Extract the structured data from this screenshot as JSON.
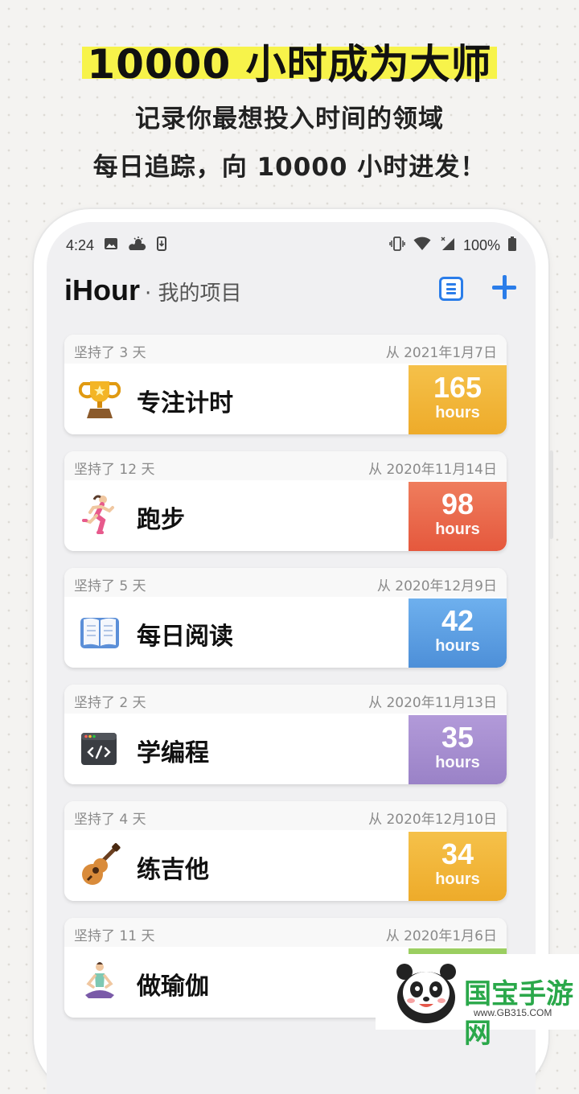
{
  "promo": {
    "title": "10000 小时成为大师",
    "subtitle1": "记录你最想投入时间的领域",
    "subtitle2": "每日追踪，向 10000 小时进发！"
  },
  "status_bar": {
    "time": "4:24",
    "battery": "100%",
    "icons": [
      "image-icon",
      "weather-icon",
      "download-icon",
      "vibrate-icon",
      "wifi-icon",
      "signal-icon",
      "battery-icon"
    ]
  },
  "appbar": {
    "app_name": "iHour",
    "subtitle": "· 我的项目",
    "list_icon": "list-icon",
    "add_icon": "plus-icon",
    "accent": "#2b7de9"
  },
  "projects": [
    {
      "kept": "坚持了 3 天",
      "since": "从 2021年1月7日",
      "name": "专注计时",
      "hours": "165",
      "unit": "hours",
      "icon": "trophy-icon",
      "color": "#f2b534"
    },
    {
      "kept": "坚持了 12 天",
      "since": "从 2020年11月14日",
      "name": "跑步",
      "hours": "98",
      "unit": "hours",
      "icon": "runner-icon",
      "color": "#eb6f4f"
    },
    {
      "kept": "坚持了 5 天",
      "since": "从 2020年12月9日",
      "name": "每日阅读",
      "hours": "42",
      "unit": "hours",
      "icon": "book-icon",
      "color": "#5fa2e3"
    },
    {
      "kept": "坚持了 2 天",
      "since": "从 2020年11月13日",
      "name": "学编程",
      "hours": "35",
      "unit": "hours",
      "icon": "code-icon",
      "color": "#a58ccf"
    },
    {
      "kept": "坚持了 4 天",
      "since": "从 2020年12月10日",
      "name": "练吉他",
      "hours": "34",
      "unit": "hours",
      "icon": "guitar-icon",
      "color": "#f2b534"
    },
    {
      "kept": "坚持了 11 天",
      "since": "从 2020年1月6日",
      "name": "做瑜伽",
      "hours": "",
      "unit": "",
      "icon": "yoga-icon",
      "color": "#8bc34a"
    }
  ],
  "watermark": {
    "text": "国宝手游网",
    "url": "www.GB315.COM",
    "icon": "panda-icon"
  }
}
